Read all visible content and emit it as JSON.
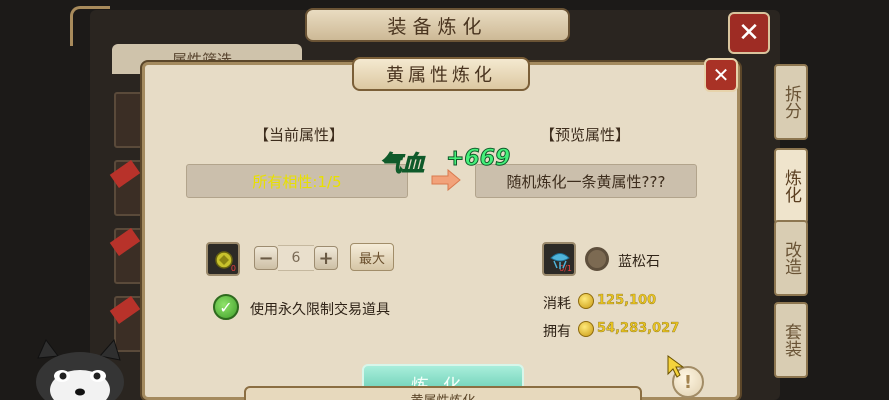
{
  "background_window": {
    "title": "装备炼化",
    "close_label": "✕",
    "filter_tab_label": "属性筛选",
    "side_tabs": [
      {
        "label": "拆分",
        "active": false
      },
      {
        "label": "炼化",
        "active": true
      },
      {
        "label": "改造",
        "active": false
      },
      {
        "label": "套装",
        "active": false
      }
    ]
  },
  "dialog": {
    "title": "黄属性炼化",
    "close_label": "✕",
    "current": {
      "header": "【当前属性】",
      "value": "所有相性:1/5"
    },
    "preview": {
      "header": "【预览属性】",
      "value": "随机炼化一条黄属性???"
    },
    "floating_text": {
      "stat": "气血",
      "amount": "+669"
    },
    "material": {
      "count_label": "0",
      "minus_label": "−",
      "quantity": "6",
      "plus_label": "+",
      "max_label": "最大"
    },
    "option": {
      "checked": true,
      "label": "使用永久限制交易道具"
    },
    "gem": {
      "count_label": "0/1",
      "name": "蓝松石"
    },
    "cost": {
      "label": "消耗",
      "value": "125,100"
    },
    "owned": {
      "label": "拥有",
      "value": "54,283,027"
    },
    "forge_button_label": "炼化",
    "help_label": "!"
  },
  "sub_window": {
    "title": "黄属性炼化"
  },
  "colors": {
    "current_attr": "#e8e000",
    "floating_text": "#46f07a",
    "money": "#e8c320",
    "dialog_bg": "#e7dcc6"
  }
}
